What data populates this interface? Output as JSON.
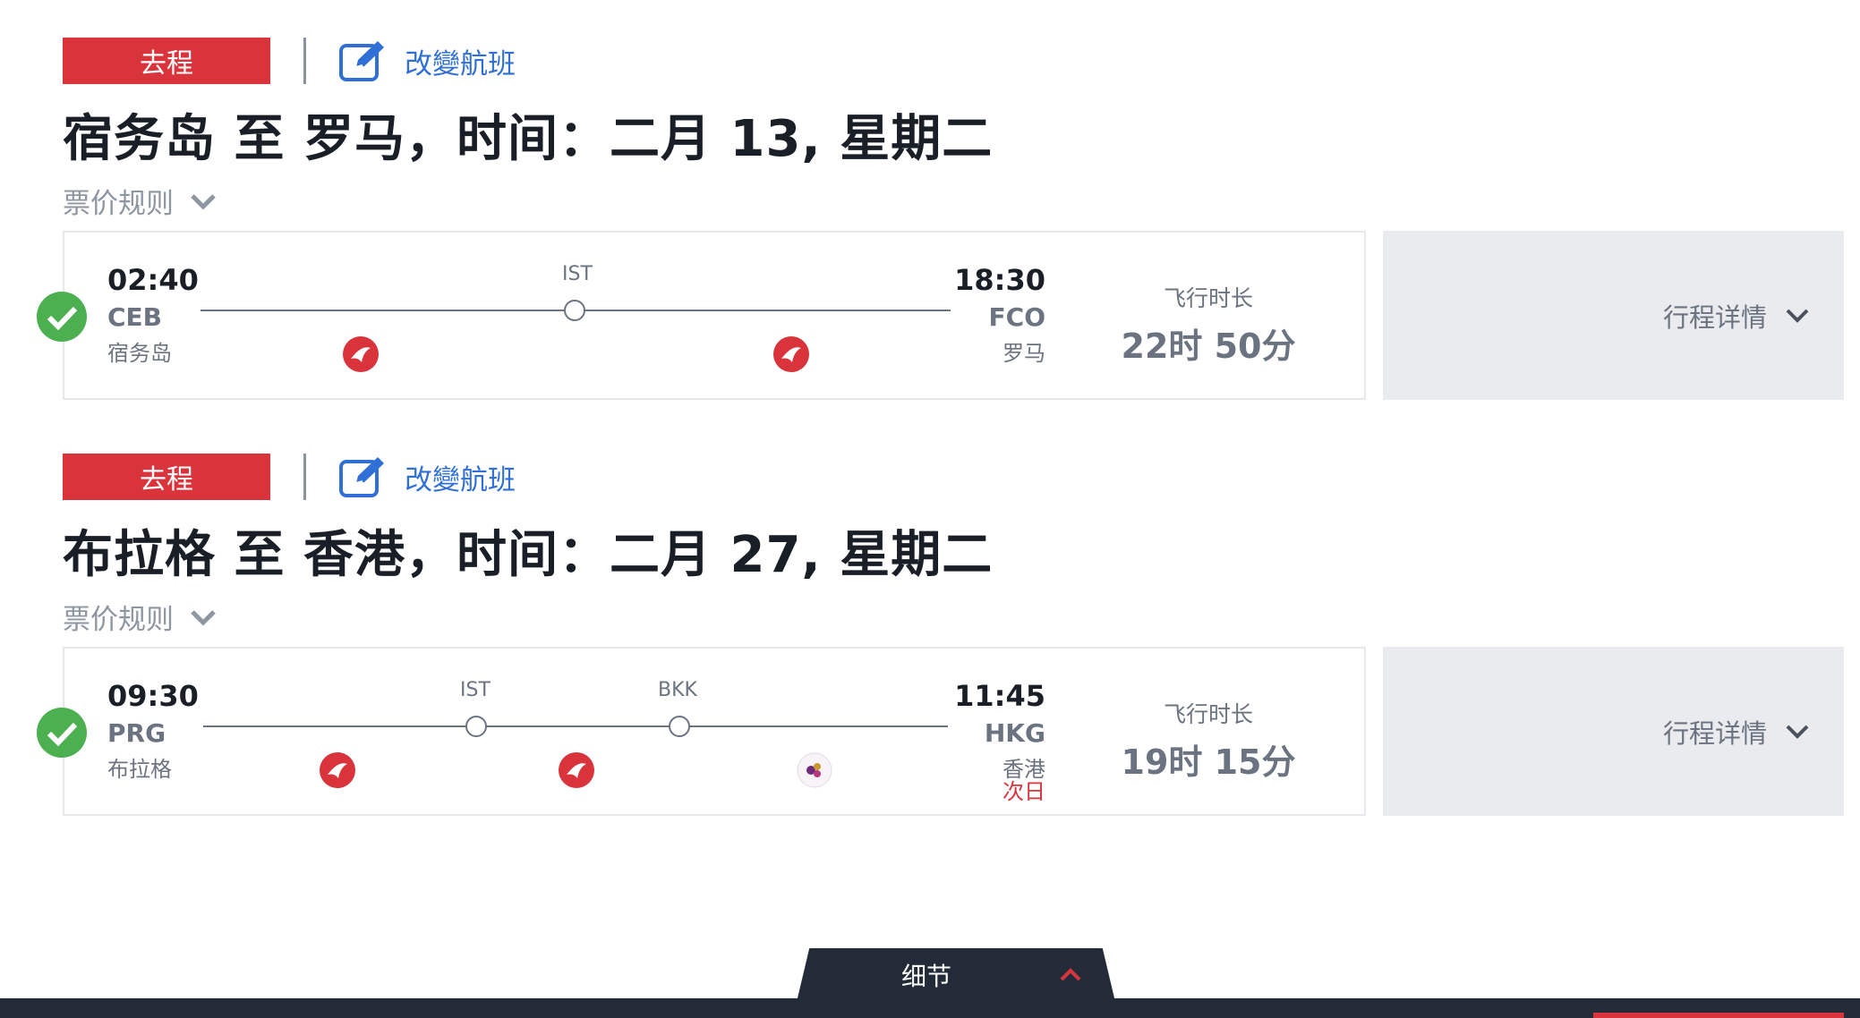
{
  "colors": {
    "accent_red": "#d9343c",
    "link_blue": "#2f6fd6",
    "check_green": "#4caf50",
    "dark_navy": "#232b38"
  },
  "segments": [
    {
      "badge": "去程",
      "change_flight": "改變航班",
      "title": "宿务岛 至 罗马，时间：二月 13, 星期二",
      "fare_rules": "票价规则",
      "departure": {
        "time": "02:40",
        "code": "CEB",
        "city": "宿务岛"
      },
      "arrival": {
        "time": "18:30",
        "code": "FCO",
        "city": "罗马",
        "next_day": ""
      },
      "stops": [
        "IST"
      ],
      "airlines": [
        "turkish-airlines-logo",
        "turkish-airlines-logo"
      ],
      "duration_label": "飞行时长",
      "duration": "22时 50分",
      "details": "行程详情"
    },
    {
      "badge": "去程",
      "change_flight": "改變航班",
      "title": "布拉格 至 香港，时间：二月 27, 星期二",
      "fare_rules": "票价规则",
      "departure": {
        "time": "09:30",
        "code": "PRG",
        "city": "布拉格"
      },
      "arrival": {
        "time": "11:45",
        "code": "HKG",
        "city": "香港",
        "next_day": "次日"
      },
      "stops": [
        "IST",
        "BKK"
      ],
      "airlines": [
        "turkish-airlines-logo",
        "turkish-airlines-logo",
        "thai-airways-logo"
      ],
      "duration_label": "飞行时长",
      "duration": "19时 15分",
      "details": "行程详情"
    }
  ],
  "bottom_tab": {
    "label": "细节",
    "icon": "chevron-up-icon"
  }
}
